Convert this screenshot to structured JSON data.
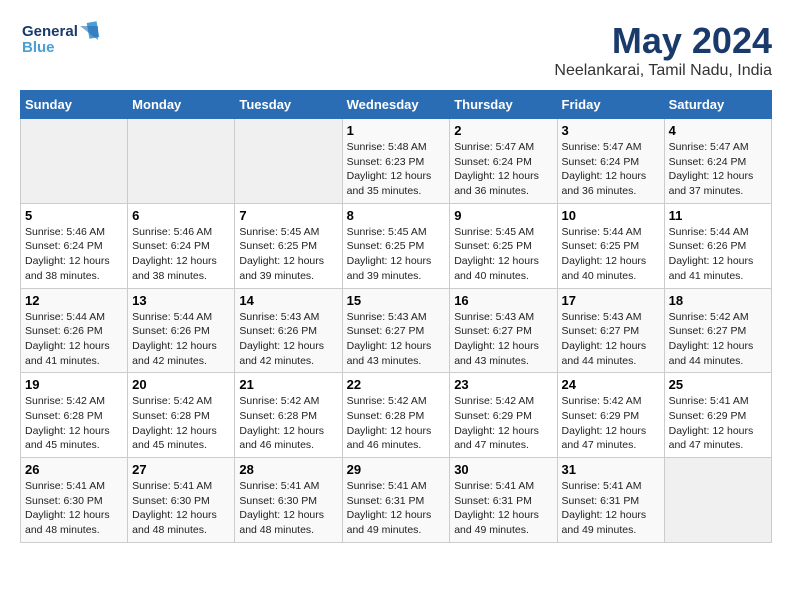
{
  "header": {
    "logo_line1": "General",
    "logo_line2": "Blue",
    "month": "May 2024",
    "location": "Neelankarai, Tamil Nadu, India"
  },
  "weekdays": [
    "Sunday",
    "Monday",
    "Tuesday",
    "Wednesday",
    "Thursday",
    "Friday",
    "Saturday"
  ],
  "weeks": [
    [
      {
        "day": "",
        "sunrise": "",
        "sunset": "",
        "daylight": ""
      },
      {
        "day": "",
        "sunrise": "",
        "sunset": "",
        "daylight": ""
      },
      {
        "day": "",
        "sunrise": "",
        "sunset": "",
        "daylight": ""
      },
      {
        "day": "1",
        "sunrise": "Sunrise: 5:48 AM",
        "sunset": "Sunset: 6:23 PM",
        "daylight": "Daylight: 12 hours and 35 minutes."
      },
      {
        "day": "2",
        "sunrise": "Sunrise: 5:47 AM",
        "sunset": "Sunset: 6:24 PM",
        "daylight": "Daylight: 12 hours and 36 minutes."
      },
      {
        "day": "3",
        "sunrise": "Sunrise: 5:47 AM",
        "sunset": "Sunset: 6:24 PM",
        "daylight": "Daylight: 12 hours and 36 minutes."
      },
      {
        "day": "4",
        "sunrise": "Sunrise: 5:47 AM",
        "sunset": "Sunset: 6:24 PM",
        "daylight": "Daylight: 12 hours and 37 minutes."
      }
    ],
    [
      {
        "day": "5",
        "sunrise": "Sunrise: 5:46 AM",
        "sunset": "Sunset: 6:24 PM",
        "daylight": "Daylight: 12 hours and 38 minutes."
      },
      {
        "day": "6",
        "sunrise": "Sunrise: 5:46 AM",
        "sunset": "Sunset: 6:24 PM",
        "daylight": "Daylight: 12 hours and 38 minutes."
      },
      {
        "day": "7",
        "sunrise": "Sunrise: 5:45 AM",
        "sunset": "Sunset: 6:25 PM",
        "daylight": "Daylight: 12 hours and 39 minutes."
      },
      {
        "day": "8",
        "sunrise": "Sunrise: 5:45 AM",
        "sunset": "Sunset: 6:25 PM",
        "daylight": "Daylight: 12 hours and 39 minutes."
      },
      {
        "day": "9",
        "sunrise": "Sunrise: 5:45 AM",
        "sunset": "Sunset: 6:25 PM",
        "daylight": "Daylight: 12 hours and 40 minutes."
      },
      {
        "day": "10",
        "sunrise": "Sunrise: 5:44 AM",
        "sunset": "Sunset: 6:25 PM",
        "daylight": "Daylight: 12 hours and 40 minutes."
      },
      {
        "day": "11",
        "sunrise": "Sunrise: 5:44 AM",
        "sunset": "Sunset: 6:26 PM",
        "daylight": "Daylight: 12 hours and 41 minutes."
      }
    ],
    [
      {
        "day": "12",
        "sunrise": "Sunrise: 5:44 AM",
        "sunset": "Sunset: 6:26 PM",
        "daylight": "Daylight: 12 hours and 41 minutes."
      },
      {
        "day": "13",
        "sunrise": "Sunrise: 5:44 AM",
        "sunset": "Sunset: 6:26 PM",
        "daylight": "Daylight: 12 hours and 42 minutes."
      },
      {
        "day": "14",
        "sunrise": "Sunrise: 5:43 AM",
        "sunset": "Sunset: 6:26 PM",
        "daylight": "Daylight: 12 hours and 42 minutes."
      },
      {
        "day": "15",
        "sunrise": "Sunrise: 5:43 AM",
        "sunset": "Sunset: 6:27 PM",
        "daylight": "Daylight: 12 hours and 43 minutes."
      },
      {
        "day": "16",
        "sunrise": "Sunrise: 5:43 AM",
        "sunset": "Sunset: 6:27 PM",
        "daylight": "Daylight: 12 hours and 43 minutes."
      },
      {
        "day": "17",
        "sunrise": "Sunrise: 5:43 AM",
        "sunset": "Sunset: 6:27 PM",
        "daylight": "Daylight: 12 hours and 44 minutes."
      },
      {
        "day": "18",
        "sunrise": "Sunrise: 5:42 AM",
        "sunset": "Sunset: 6:27 PM",
        "daylight": "Daylight: 12 hours and 44 minutes."
      }
    ],
    [
      {
        "day": "19",
        "sunrise": "Sunrise: 5:42 AM",
        "sunset": "Sunset: 6:28 PM",
        "daylight": "Daylight: 12 hours and 45 minutes."
      },
      {
        "day": "20",
        "sunrise": "Sunrise: 5:42 AM",
        "sunset": "Sunset: 6:28 PM",
        "daylight": "Daylight: 12 hours and 45 minutes."
      },
      {
        "day": "21",
        "sunrise": "Sunrise: 5:42 AM",
        "sunset": "Sunset: 6:28 PM",
        "daylight": "Daylight: 12 hours and 46 minutes."
      },
      {
        "day": "22",
        "sunrise": "Sunrise: 5:42 AM",
        "sunset": "Sunset: 6:28 PM",
        "daylight": "Daylight: 12 hours and 46 minutes."
      },
      {
        "day": "23",
        "sunrise": "Sunrise: 5:42 AM",
        "sunset": "Sunset: 6:29 PM",
        "daylight": "Daylight: 12 hours and 47 minutes."
      },
      {
        "day": "24",
        "sunrise": "Sunrise: 5:42 AM",
        "sunset": "Sunset: 6:29 PM",
        "daylight": "Daylight: 12 hours and 47 minutes."
      },
      {
        "day": "25",
        "sunrise": "Sunrise: 5:41 AM",
        "sunset": "Sunset: 6:29 PM",
        "daylight": "Daylight: 12 hours and 47 minutes."
      }
    ],
    [
      {
        "day": "26",
        "sunrise": "Sunrise: 5:41 AM",
        "sunset": "Sunset: 6:30 PM",
        "daylight": "Daylight: 12 hours and 48 minutes."
      },
      {
        "day": "27",
        "sunrise": "Sunrise: 5:41 AM",
        "sunset": "Sunset: 6:30 PM",
        "daylight": "Daylight: 12 hours and 48 minutes."
      },
      {
        "day": "28",
        "sunrise": "Sunrise: 5:41 AM",
        "sunset": "Sunset: 6:30 PM",
        "daylight": "Daylight: 12 hours and 48 minutes."
      },
      {
        "day": "29",
        "sunrise": "Sunrise: 5:41 AM",
        "sunset": "Sunset: 6:31 PM",
        "daylight": "Daylight: 12 hours and 49 minutes."
      },
      {
        "day": "30",
        "sunrise": "Sunrise: 5:41 AM",
        "sunset": "Sunset: 6:31 PM",
        "daylight": "Daylight: 12 hours and 49 minutes."
      },
      {
        "day": "31",
        "sunrise": "Sunrise: 5:41 AM",
        "sunset": "Sunset: 6:31 PM",
        "daylight": "Daylight: 12 hours and 49 minutes."
      },
      {
        "day": "",
        "sunrise": "",
        "sunset": "",
        "daylight": ""
      }
    ]
  ]
}
